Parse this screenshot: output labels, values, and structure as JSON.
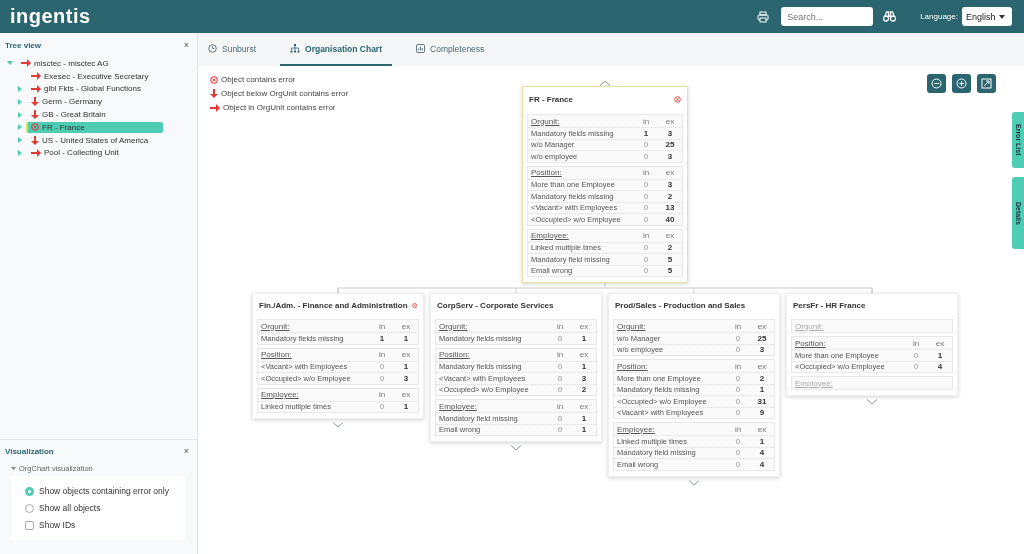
{
  "header": {
    "logo": "ingentis",
    "search": {
      "placeholder": "Search..."
    },
    "language_label": "Language:",
    "language": "English"
  },
  "tree_panel": {
    "title": "Tree view",
    "close": "×",
    "items": [
      {
        "label": "misctec - misctec AG",
        "kind": "in-orgunit",
        "expanded": true,
        "selected": false,
        "children": [
          {
            "label": "Exesec - Executive Secretary",
            "kind": "in-orgunit",
            "selected": false
          },
          {
            "label": "glbl Fkts - Global Functions",
            "kind": "in-orgunit",
            "expanded": false,
            "selected": false
          },
          {
            "label": "Germ - Germany",
            "kind": "below",
            "expanded": false,
            "selected": false
          },
          {
            "label": "GB - Great Britain",
            "kind": "below",
            "expanded": false,
            "selected": false
          },
          {
            "label": "FR - France",
            "kind": "error",
            "expanded": false,
            "selected": true
          },
          {
            "label": "US - United States of America",
            "kind": "below",
            "expanded": false,
            "selected": false
          },
          {
            "label": "Pool - Collecting Unit",
            "kind": "in-orgunit",
            "expanded": false,
            "selected": false
          }
        ]
      }
    ]
  },
  "visualization_panel": {
    "title": "Visualization",
    "close": "×",
    "group": "OrgChart visualization",
    "options": [
      {
        "kind": "radio",
        "label": "Show objects containing error only",
        "selected": true
      },
      {
        "kind": "radio",
        "label": "Show all objects",
        "selected": false
      },
      {
        "kind": "checkbox",
        "label": "Show IDs",
        "checked": false
      }
    ]
  },
  "tabs": [
    {
      "label": "Sunburst",
      "selected": false
    },
    {
      "label": "Organisation Chart",
      "selected": true
    },
    {
      "label": "Completeness",
      "selected": false
    }
  ],
  "legend": [
    {
      "kind": "error",
      "label": "Object contains error"
    },
    {
      "kind": "below",
      "label": "Object below OrgUnit contains error"
    },
    {
      "kind": "in-orgunit",
      "label": "Object in OrgUnit contains error"
    }
  ],
  "side_tabs": [
    "Error List",
    "Details"
  ],
  "root_card": {
    "title": "FR - France",
    "error": true,
    "selected": true,
    "sections": [
      {
        "heading": "Orgunit:",
        "empty": false,
        "columns": [
          "in",
          "ex"
        ],
        "rows": [
          {
            "label": "Mandatory fields missing",
            "in": "1",
            "in_active": true,
            "ex": "3"
          },
          {
            "label": "w/o Manager",
            "in": "0",
            "in_active": false,
            "ex": "25"
          },
          {
            "label": "w/o employee",
            "in": "0",
            "in_active": false,
            "ex": "3"
          }
        ]
      },
      {
        "heading": "Position:",
        "empty": false,
        "columns": [
          "in",
          "ex"
        ],
        "rows": [
          {
            "label": "More than one Employee",
            "in": "0",
            "in_active": false,
            "ex": "3"
          },
          {
            "label": "Mandatory fields missing",
            "in": "0",
            "in_active": false,
            "ex": "2"
          },
          {
            "label": "<Vacant> with Employees",
            "in": "0",
            "in_active": false,
            "ex": "13"
          },
          {
            "label": "<Occupied> w/o Employee",
            "in": "0",
            "in_active": false,
            "ex": "40"
          }
        ]
      },
      {
        "heading": "Employee:",
        "empty": false,
        "columns": [
          "in",
          "ex"
        ],
        "rows": [
          {
            "label": "Linked multiple times",
            "in": "0",
            "in_active": false,
            "ex": "2"
          },
          {
            "label": "Mandatory field missing",
            "in": "0",
            "in_active": false,
            "ex": "5"
          },
          {
            "label": "Email wrong",
            "in": "0",
            "in_active": false,
            "ex": "5"
          }
        ]
      }
    ]
  },
  "child_cards": [
    {
      "title": "Fin./Adm. - Finance and Administration",
      "error": true,
      "selected": false,
      "sections": [
        {
          "heading": "Orgunit:",
          "empty": false,
          "columns": [
            "in",
            "ex"
          ],
          "rows": [
            {
              "label": "Mandatory fields missing",
              "in": "1",
              "in_active": true,
              "ex": "1"
            }
          ]
        },
        {
          "heading": "Position:",
          "empty": false,
          "columns": [
            "in",
            "ex"
          ],
          "rows": [
            {
              "label": "<Vacant> with Employees",
              "in": "0",
              "in_active": false,
              "ex": "1"
            },
            {
              "label": "<Occupied> w/o Employee",
              "in": "0",
              "in_active": false,
              "ex": "3"
            }
          ]
        },
        {
          "heading": "Employee:",
          "empty": false,
          "columns": [
            "in",
            "ex"
          ],
          "rows": [
            {
              "label": "Linked multiple times",
              "in": "0",
              "in_active": false,
              "ex": "1"
            }
          ]
        }
      ]
    },
    {
      "title": "CorpServ - Corporate Services",
      "error": false,
      "selected": false,
      "sections": [
        {
          "heading": "Orgunit:",
          "empty": false,
          "columns": [
            "in",
            "ex"
          ],
          "rows": [
            {
              "label": "Mandatory fields missing",
              "in": "0",
              "in_active": false,
              "ex": "1"
            }
          ]
        },
        {
          "heading": "Position:",
          "empty": false,
          "columns": [
            "in",
            "ex"
          ],
          "rows": [
            {
              "label": "Mandatory fields missing",
              "in": "0",
              "in_active": false,
              "ex": "1"
            },
            {
              "label": "<Vacant> with Employees",
              "in": "0",
              "in_active": false,
              "ex": "3"
            },
            {
              "label": "<Occupied> w/o Employee",
              "in": "0",
              "in_active": false,
              "ex": "2"
            }
          ]
        },
        {
          "heading": "Employee:",
          "empty": false,
          "columns": [
            "in",
            "ex"
          ],
          "rows": [
            {
              "label": "Mandatory field missing",
              "in": "0",
              "in_active": false,
              "ex": "1"
            },
            {
              "label": "Email wrong",
              "in": "0",
              "in_active": false,
              "ex": "1"
            }
          ]
        }
      ]
    },
    {
      "title": "Prod/Sales - Production and Sales",
      "error": false,
      "selected": false,
      "sections": [
        {
          "heading": "Orgunit:",
          "empty": false,
          "columns": [
            "in",
            "ex"
          ],
          "rows": [
            {
              "label": "w/o Manager",
              "in": "0",
              "in_active": false,
              "ex": "25"
            },
            {
              "label": "w/o employee",
              "in": "0",
              "in_active": false,
              "ex": "3"
            }
          ]
        },
        {
          "heading": "Position:",
          "empty": false,
          "columns": [
            "in",
            "ex"
          ],
          "rows": [
            {
              "label": "More than one Employee",
              "in": "0",
              "in_active": false,
              "ex": "2"
            },
            {
              "label": "Mandatory fields missing",
              "in": "0",
              "in_active": false,
              "ex": "1"
            },
            {
              "label": "<Occupied> w/o Employee",
              "in": "0",
              "in_active": false,
              "ex": "31"
            },
            {
              "label": "<Vacant> with Employees",
              "in": "0",
              "in_active": false,
              "ex": "9"
            }
          ]
        },
        {
          "heading": "Employee:",
          "empty": false,
          "columns": [
            "in",
            "ex"
          ],
          "rows": [
            {
              "label": "Linked multiple times",
              "in": "0",
              "in_active": false,
              "ex": "1"
            },
            {
              "label": "Mandatory field missing",
              "in": "0",
              "in_active": false,
              "ex": "4"
            },
            {
              "label": "Email wrong",
              "in": "0",
              "in_active": false,
              "ex": "4"
            }
          ]
        }
      ]
    },
    {
      "title": "PersFr - HR France",
      "error": false,
      "selected": false,
      "sections": [
        {
          "heading": "Orgunit:",
          "empty": true
        },
        {
          "heading": "Position:",
          "empty": false,
          "columns": [
            "in",
            "ex"
          ],
          "rows": [
            {
              "label": "More than one Employee",
              "in": "0",
              "in_active": false,
              "ex": "1"
            },
            {
              "label": "<Occupied> w/o Employee",
              "in": "0",
              "in_active": false,
              "ex": "4"
            }
          ]
        },
        {
          "heading": "Employee:",
          "empty": true
        }
      ]
    }
  ]
}
